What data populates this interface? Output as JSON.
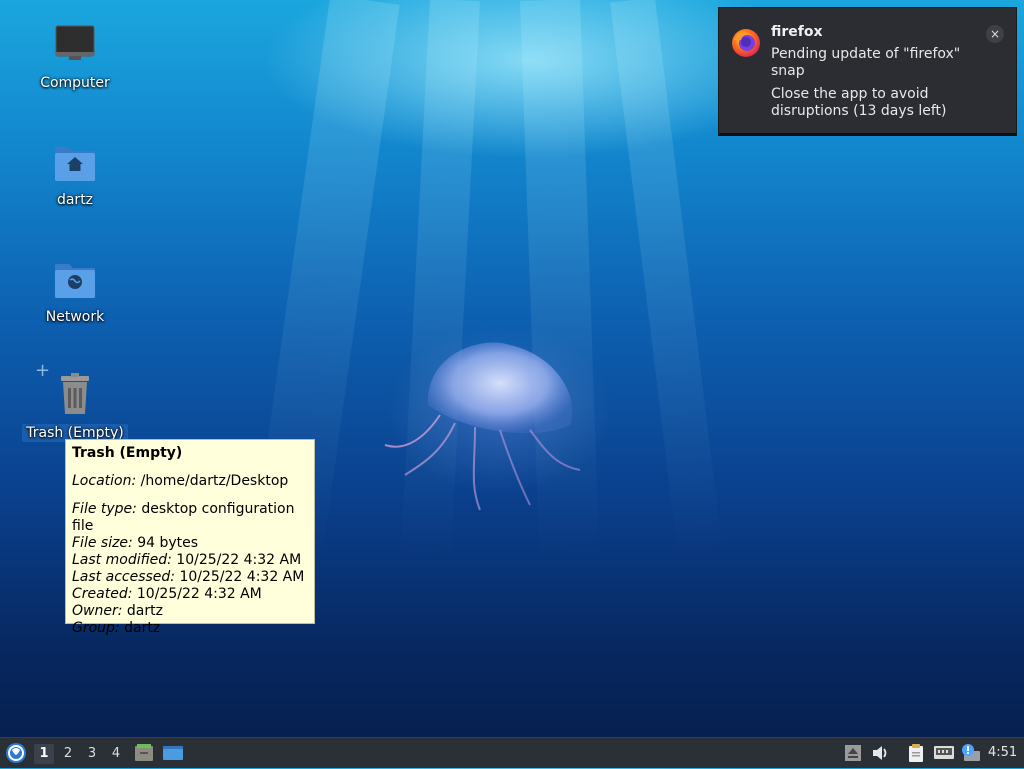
{
  "desktop": {
    "icons": [
      {
        "label": "Computer",
        "icon": "computer-icon"
      },
      {
        "label": "dartz",
        "icon": "home-folder-icon"
      },
      {
        "label": "Network",
        "icon": "network-folder-icon"
      },
      {
        "label": "Trash (Empty)",
        "icon": "trash-icon"
      }
    ]
  },
  "tooltip": {
    "title": "Trash (Empty)",
    "location_label": "Location:",
    "location_value": " /home/dartz/Desktop",
    "file_type_label": "File type:",
    "file_type_value": " desktop configuration file",
    "file_size_label": "File size:",
    "file_size_value": " 94 bytes",
    "last_modified_label": "Last modified:",
    "last_modified_value": " 10/25/22 4:32 AM",
    "last_accessed_label": "Last accessed:",
    "last_accessed_value": " 10/25/22 4:32 AM",
    "created_label": "Created:",
    "created_value": " 10/25/22 4:32 AM",
    "owner_label": "Owner:",
    "owner_value": " dartz",
    "group_label": "Group:",
    "group_value": " dartz"
  },
  "notification": {
    "app": "firefox",
    "line1": "Pending update of \"firefox\" snap",
    "line2": "Close the app to avoid disruptions (13 days left)",
    "close_label": "×",
    "icon": "firefox-icon"
  },
  "panel": {
    "workspaces": [
      "1",
      "2",
      "3",
      "4"
    ],
    "active_workspace": "1",
    "clock": "4:51",
    "launcher_icons": [
      "file-manager-icon",
      "show-desktop-icon"
    ],
    "tray_icons": [
      "eject-icon",
      "volume-icon",
      "clipboard-icon",
      "network-wired-icon",
      "update-notifier-icon"
    ]
  },
  "colors": {
    "panel_bg": "#2b3037",
    "tooltip_bg": "#ffffdc",
    "notification_bg": "#2b2d33",
    "folder_blue": "#4a90d9"
  }
}
